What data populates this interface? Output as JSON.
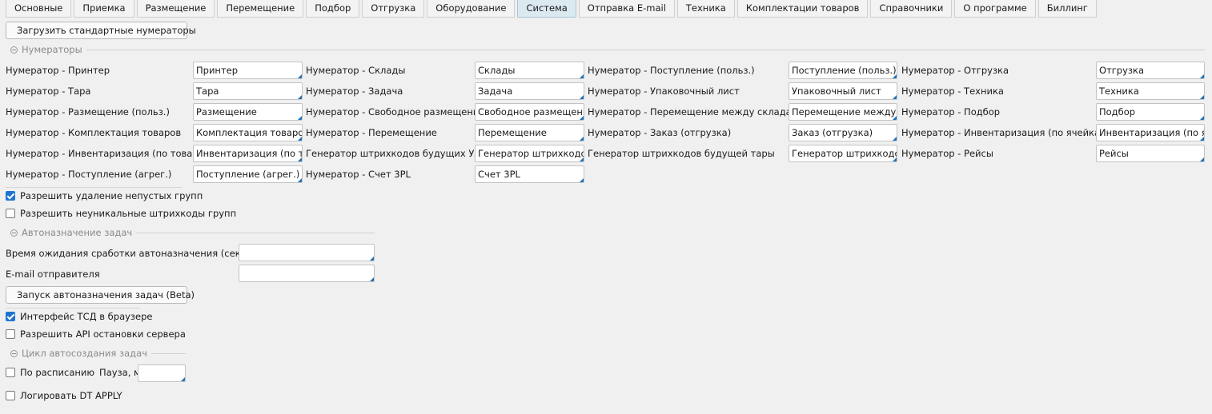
{
  "tabs": [
    {
      "label": "Основные"
    },
    {
      "label": "Приемка"
    },
    {
      "label": "Размещение"
    },
    {
      "label": "Перемещение"
    },
    {
      "label": "Подбор"
    },
    {
      "label": "Отгрузка"
    },
    {
      "label": "Оборудование"
    },
    {
      "label": "Система",
      "active": true
    },
    {
      "label": "Отправка E-mail"
    },
    {
      "label": "Техника"
    },
    {
      "label": "Комплектации товаров"
    },
    {
      "label": "Справочники"
    },
    {
      "label": "О программе"
    },
    {
      "label": "Биллинг"
    }
  ],
  "toolbar": {
    "load_numerators_label": "Загрузить стандартные нумераторы"
  },
  "numerators": {
    "group_title": "Нумераторы",
    "columns": [
      [
        {
          "label": "Нумератор - Принтер",
          "value": "Принтер"
        },
        {
          "label": "Нумератор - Тара",
          "value": "Тара"
        },
        {
          "label": "Нумератор - Размещение (польз.)",
          "value": "Размещение"
        },
        {
          "label": "Нумератор - Комплектация товаров",
          "value": "Комплектация товаров"
        },
        {
          "label": "Нумератор - Инвентаризация (по товару)",
          "value": "Инвентаризация (по товару)"
        },
        {
          "label": "Нумератор - Поступление (агрег.)",
          "value": "Поступление (агрег.)"
        }
      ],
      [
        {
          "label": "Нумератор - Склады",
          "value": "Склады"
        },
        {
          "label": "Нумератор - Задача",
          "value": "Задача"
        },
        {
          "label": "Нумератор - Свободное размещение",
          "value": "Свободное размещение"
        },
        {
          "label": "Нумератор - Перемещение",
          "value": "Перемещение"
        },
        {
          "label": "Генератор штрихкодов будущих УЛ",
          "value": "Генератор штрихкодов будущих УЛ"
        },
        {
          "label": "Нумератор - Счет 3PL",
          "value": "Счет 3PL"
        }
      ],
      [
        {
          "label": "Нумератор - Поступление (польз.)",
          "value": "Поступление (польз.)"
        },
        {
          "label": "Нумератор - Упаковочный лист",
          "value": "Упаковочный лист"
        },
        {
          "label": "Нумератор - Перемещение между складами",
          "value": "Перемещение между складами"
        },
        {
          "label": "Нумератор - Заказ (отгрузка)",
          "value": "Заказ (отгрузка)"
        },
        {
          "label": "Генератор штрихкодов будущей тары",
          "value": "Генератор штрихкодов будущей тары"
        }
      ],
      [
        {
          "label": "Нумератор - Отгрузка",
          "value": "Отгрузка"
        },
        {
          "label": "Нумератор - Техника",
          "value": "Техника"
        },
        {
          "label": "Нумератор - Подбор",
          "value": "Подбор"
        },
        {
          "label": "Нумератор - Инвентаризация (по ячейкам)",
          "value": "Инвентаризация (по ячейкам)"
        },
        {
          "label": "Нумератор - Рейсы",
          "value": "Рейсы"
        }
      ]
    ]
  },
  "options": {
    "allow_delete_nonempty_groups": {
      "label": "Разрешить удаление непустых групп",
      "checked": true
    },
    "allow_nonunique_group_barcodes": {
      "label": "Разрешить неуникальные штрихкоды групп",
      "checked": false
    }
  },
  "autoassign": {
    "group_title": "Автоназначение задач",
    "wait_time_label": "Время ожидания сработки автоназначения (секунд)",
    "wait_time_value": "",
    "email_label": "E-mail отправителя",
    "email_value": "",
    "run_button_label": "Запуск автоназначения задач (Beta)"
  },
  "options2": {
    "tsd_browser": {
      "label": "Интерфейс ТСД в браузере",
      "checked": true
    },
    "allow_api_stop": {
      "label": "Разрешить API остановки сервера",
      "checked": false
    }
  },
  "cycle": {
    "group_title": "Цикл автосоздания задач",
    "schedule_label": "По расписанию",
    "schedule_checked": false,
    "pause_label": "Пауза, мс",
    "pause_value": ""
  },
  "log_dt_apply": {
    "label": "Логировать DT APPLY",
    "checked": false
  },
  "colors": {
    "accent": "#1e75d0",
    "active_tab": "#dbe9f1"
  }
}
